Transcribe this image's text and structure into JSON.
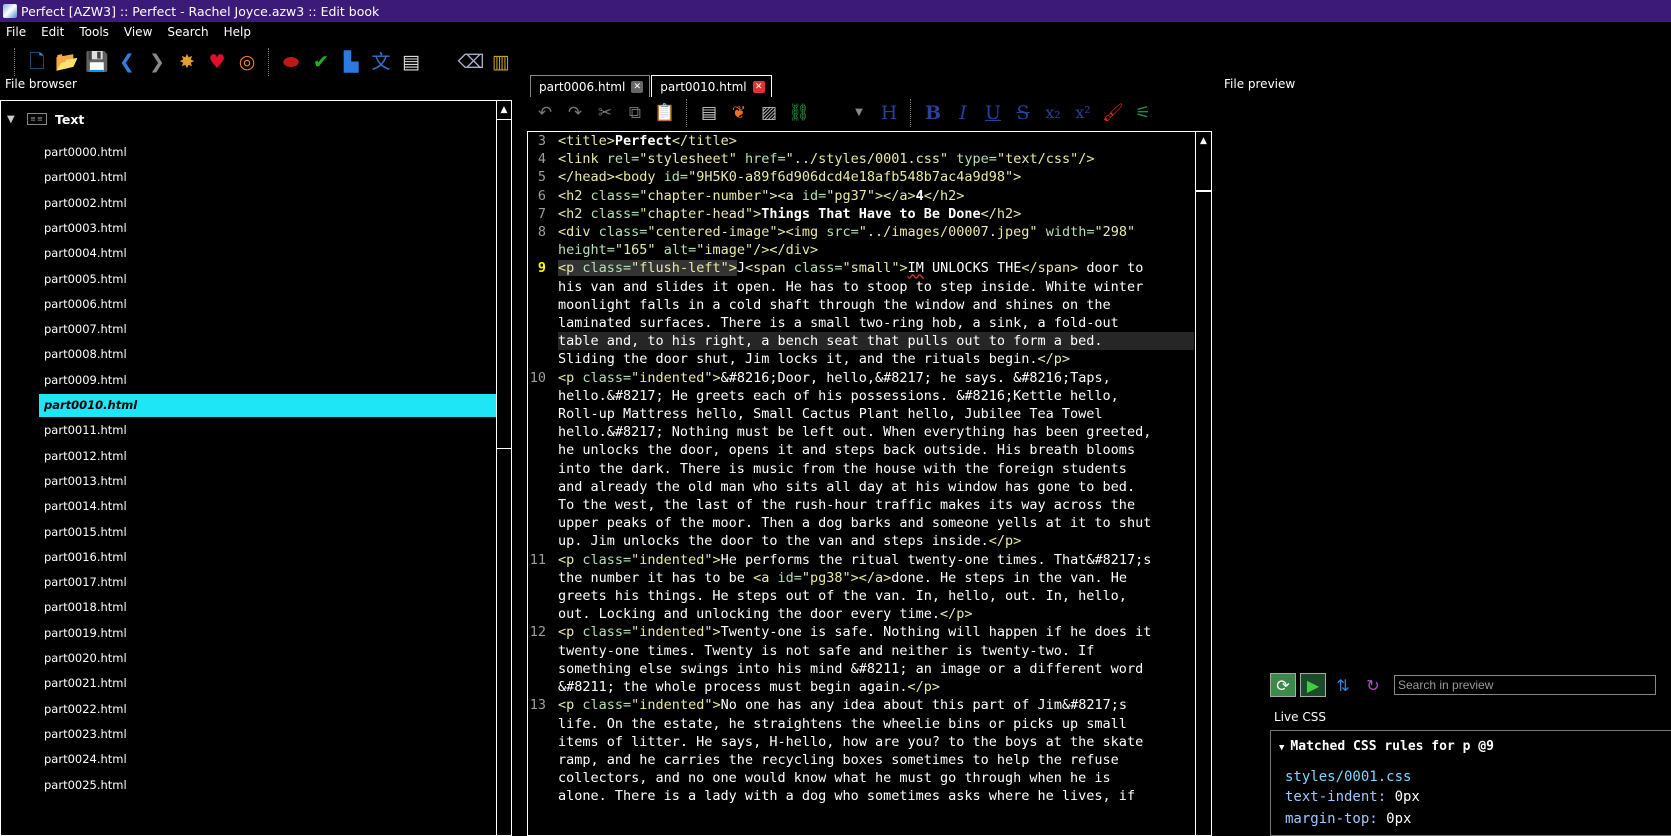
{
  "window": {
    "title": "Perfect [AZW3] :: Perfect - Rachel Joyce.azw3 :: Edit book"
  },
  "menu": [
    "File",
    "Edit",
    "Tools",
    "View",
    "Search",
    "Help"
  ],
  "panels": {
    "file_browser": "File browser",
    "file_preview": "File preview",
    "live_css": "Live CSS"
  },
  "file_browser": {
    "group": "Text",
    "files": [
      "part0000.html",
      "part0001.html",
      "part0002.html",
      "part0003.html",
      "part0004.html",
      "part0005.html",
      "part0006.html",
      "part0007.html",
      "part0008.html",
      "part0009.html",
      "part0010.html",
      "part0011.html",
      "part0012.html",
      "part0013.html",
      "part0014.html",
      "part0015.html",
      "part0016.html",
      "part0017.html",
      "part0018.html",
      "part0019.html",
      "part0020.html",
      "part0021.html",
      "part0022.html",
      "part0023.html",
      "part0024.html",
      "part0025.html"
    ],
    "selected": "part0010.html"
  },
  "tabs": [
    {
      "label": "part0006.html",
      "active": false
    },
    {
      "label": "part0010.html",
      "active": true
    }
  ],
  "editor": {
    "current_line": 9
  },
  "preview": {
    "search_placeholder": "Search in preview"
  },
  "live_css": {
    "header": "Matched CSS rules for p @9",
    "source": "styles/0001.css",
    "rules": [
      {
        "prop": "text-indent",
        "value": "0px"
      },
      {
        "prop": "margin-top",
        "value": "0px"
      }
    ]
  },
  "colors": {
    "titlebar": "#3b1a78",
    "selection": "#1ee6f7",
    "tag": "#e9e9a5",
    "attribute": "#b3e0b3",
    "current_line_number": "#ffff00"
  }
}
